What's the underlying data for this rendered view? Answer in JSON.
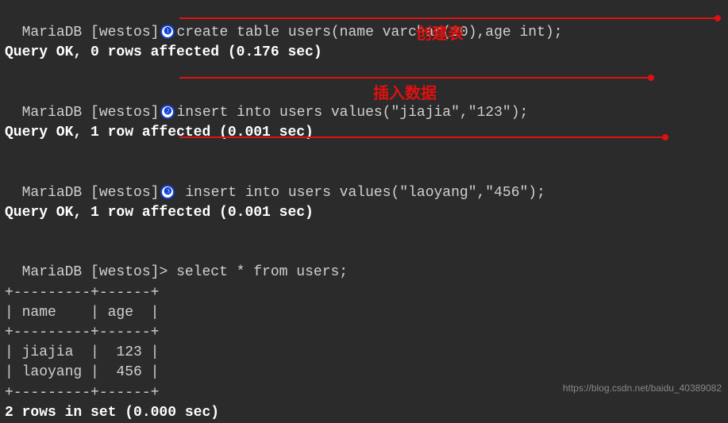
{
  "prompt": "MariaDB [westos]",
  "entries": [
    {
      "cmd": "create table users(name varchar(20),age int);",
      "result": "Query OK, 0 rows affected (0.176 sec)",
      "badge": "❶",
      "annotation": "创建表"
    },
    {
      "cmd": "insert into users values(\"jiajia\",\"123\");",
      "result": "Query OK, 1 row affected (0.001 sec)",
      "badge": "❷",
      "annotation": "插入数据"
    },
    {
      "cmd": " insert into users values(\"laoyang\",\"456\");",
      "result": "Query OK, 1 row affected (0.001 sec)",
      "badge": "❸",
      "annotation": ""
    },
    {
      "cmd": "select * from users;",
      "result": "",
      "badge": "",
      "prompt_suffix": ">"
    }
  ],
  "table": {
    "border": "+---------+------+",
    "header": "| name    | age  |",
    "rows": [
      "| jiajia  |  123 |",
      "| laoyang |  456 |"
    ]
  },
  "footer": "2 rows in set (0.000 sec)",
  "watermark": "https://blog.csdn.net/baidu_40389082",
  "chart_data": {
    "type": "table",
    "columns": [
      "name",
      "age"
    ],
    "rows": [
      {
        "name": "jiajia",
        "age": 123
      },
      {
        "name": "laoyang",
        "age": 456
      }
    ]
  }
}
